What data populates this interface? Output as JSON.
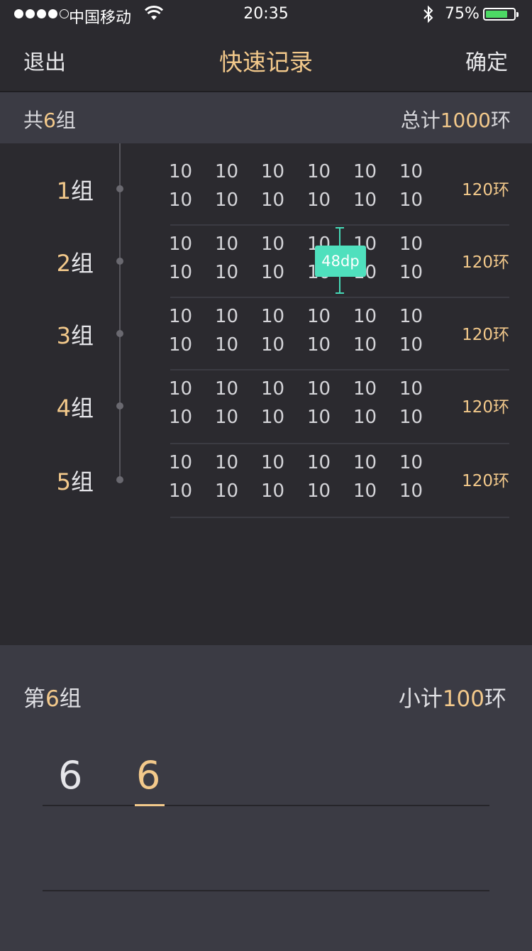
{
  "status_bar": {
    "carrier": "中国移动",
    "time": "20:35",
    "battery_percent": "75%",
    "battery_level": 0.75,
    "signal_dots_filled": 4,
    "signal_dots_total": 5,
    "icons": [
      "signal-dots-icon",
      "wifi-icon",
      "bluetooth-icon",
      "battery-icon"
    ]
  },
  "nav": {
    "exit_label": "退出",
    "title": "快速记录",
    "confirm_label": "确定"
  },
  "summary": {
    "count_prefix": "共",
    "count_value": "6",
    "count_suffix": "组",
    "total_prefix": "总计",
    "total_value": "1000",
    "total_suffix": "环"
  },
  "groups": [
    {
      "num": "1",
      "suffix": "组",
      "scores": [
        [
          "10",
          "10",
          "10",
          "10",
          "10",
          "10"
        ],
        [
          "10",
          "10",
          "10",
          "10",
          "10",
          "10"
        ]
      ],
      "total": "120环"
    },
    {
      "num": "2",
      "suffix": "组",
      "scores": [
        [
          "10",
          "10",
          "10",
          "10",
          "10",
          "10"
        ],
        [
          "10",
          "10",
          "10",
          "10",
          "10",
          "10"
        ]
      ],
      "total": "120环"
    },
    {
      "num": "3",
      "suffix": "组",
      "scores": [
        [
          "10",
          "10",
          "10",
          "10",
          "10",
          "10"
        ],
        [
          "10",
          "10",
          "10",
          "10",
          "10",
          "10"
        ]
      ],
      "total": "120环"
    },
    {
      "num": "4",
      "suffix": "组",
      "scores": [
        [
          "10",
          "10",
          "10",
          "10",
          "10",
          "10"
        ],
        [
          "10",
          "10",
          "10",
          "10",
          "10",
          "10"
        ]
      ],
      "total": "120环"
    },
    {
      "num": "5",
      "suffix": "组",
      "scores": [
        [
          "10",
          "10",
          "10",
          "10",
          "10",
          "10"
        ],
        [
          "10",
          "10",
          "10",
          "10",
          "10",
          "10"
        ]
      ],
      "total": "120环"
    }
  ],
  "annotation": {
    "label": "48dp"
  },
  "current_group": {
    "prefix": "第",
    "num": "6",
    "suffix": "组",
    "subtotal_prefix": "小计",
    "subtotal_value": "100",
    "subtotal_suffix": "环",
    "entries": [
      "6",
      "6"
    ]
  },
  "colors": {
    "accent": "#f3c98b",
    "background": "#2b2a2f",
    "panel": "#3b3b44",
    "annotation": "#4fe0bd",
    "battery": "#4cd964"
  }
}
